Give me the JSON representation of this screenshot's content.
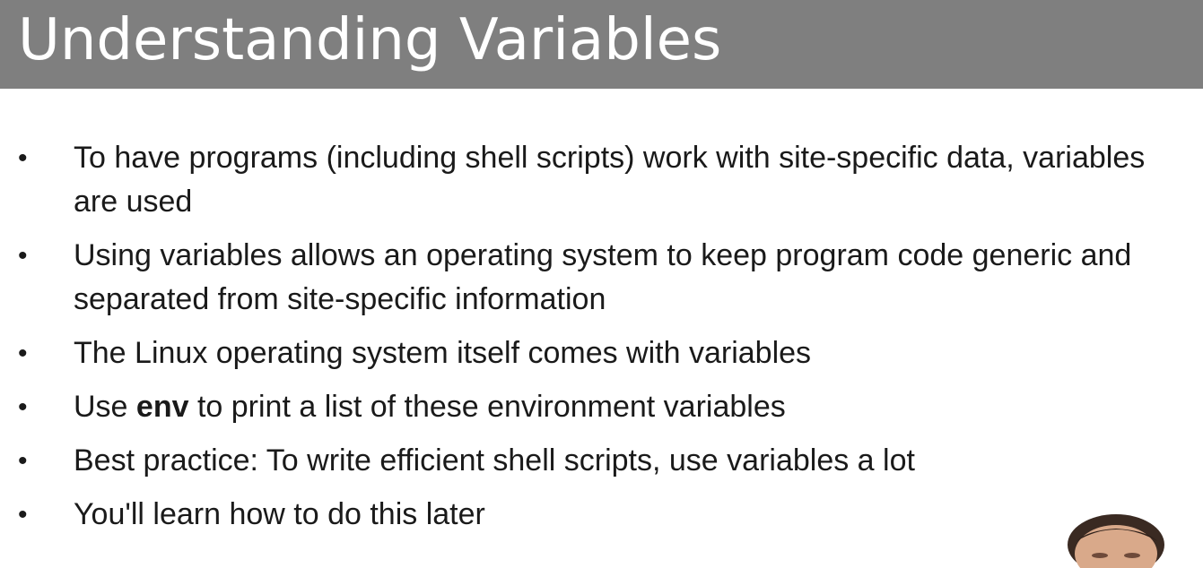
{
  "slide": {
    "title": "Understanding Variables",
    "bullets": [
      {
        "text": "To have programs (including shell scripts) work with site-specific data, variables are used"
      },
      {
        "text": "Using variables allows an operating system to keep program code generic and separated from site-specific information"
      },
      {
        "text": "The Linux operating system itself comes with variables"
      },
      {
        "before": "Use ",
        "bold": "env",
        "after": " to print a list of these environment variables"
      },
      {
        "text": "Best practice: To write efficient shell scripts, use variables a lot"
      },
      {
        "text": "You'll learn how to do this later"
      }
    ]
  },
  "colors": {
    "title_bar": "#7f7f7f",
    "title_text": "#ffffff",
    "body_text": "#1a1a1a",
    "background": "#ffffff"
  }
}
